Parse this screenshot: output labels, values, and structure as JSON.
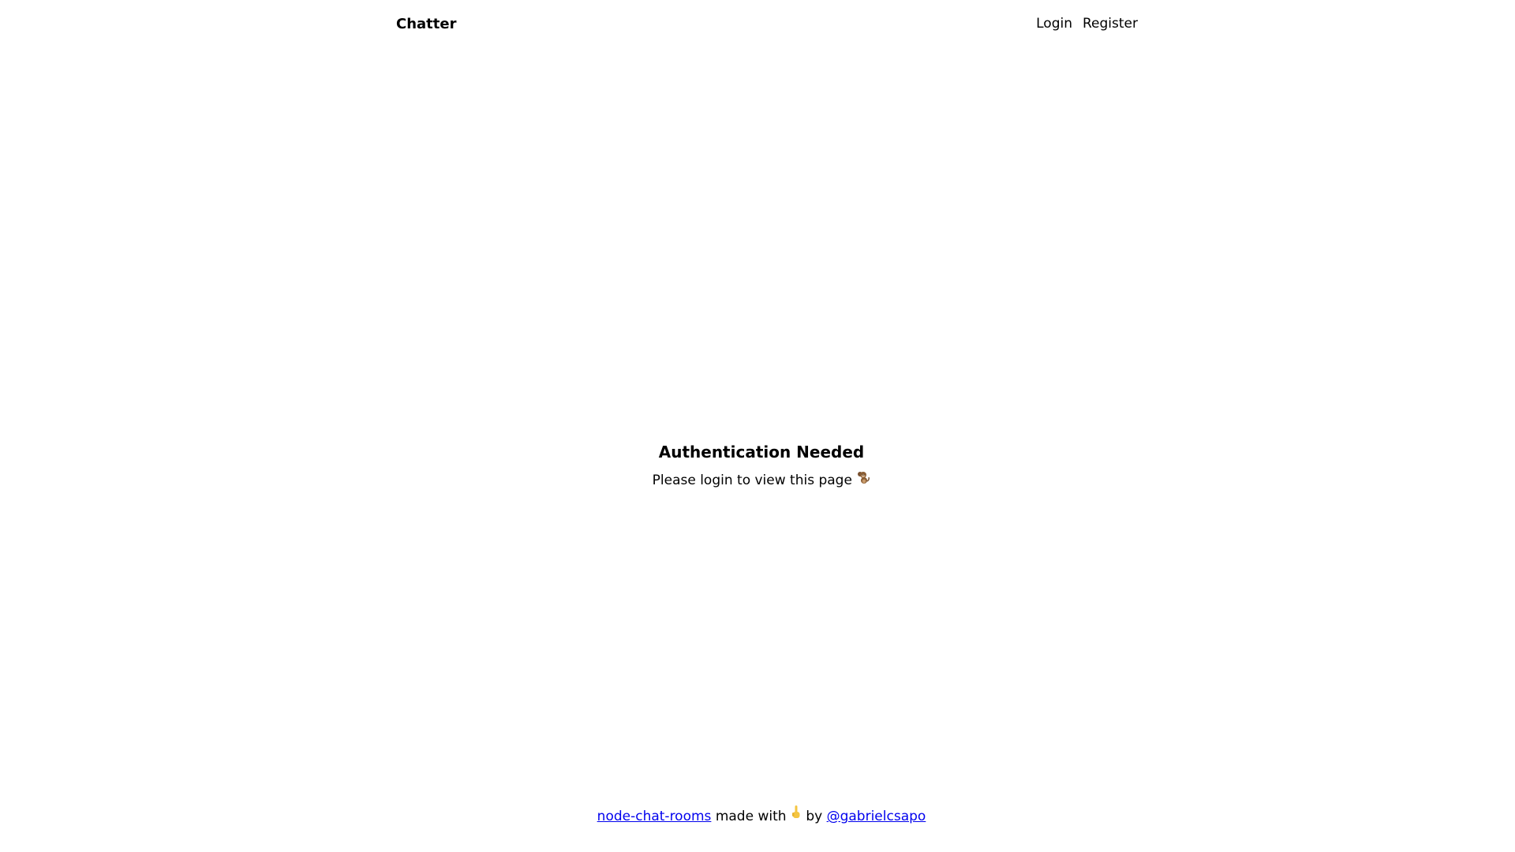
{
  "header": {
    "brand": "Chatter",
    "nav": [
      {
        "label": "Login"
      },
      {
        "label": "Register"
      }
    ]
  },
  "main": {
    "title": "Authentication Needed",
    "message": "Please login to view this page",
    "message_icon": "monkey-icon"
  },
  "footer": {
    "project_link": "node-chat-rooms",
    "made_with": "made with",
    "made_with_icon": "pointing-finger-icon",
    "by": "by",
    "author_link": "@gabrielcsapo"
  },
  "colors": {
    "link": "#0000ee",
    "text": "#000000",
    "background": "#ffffff"
  }
}
